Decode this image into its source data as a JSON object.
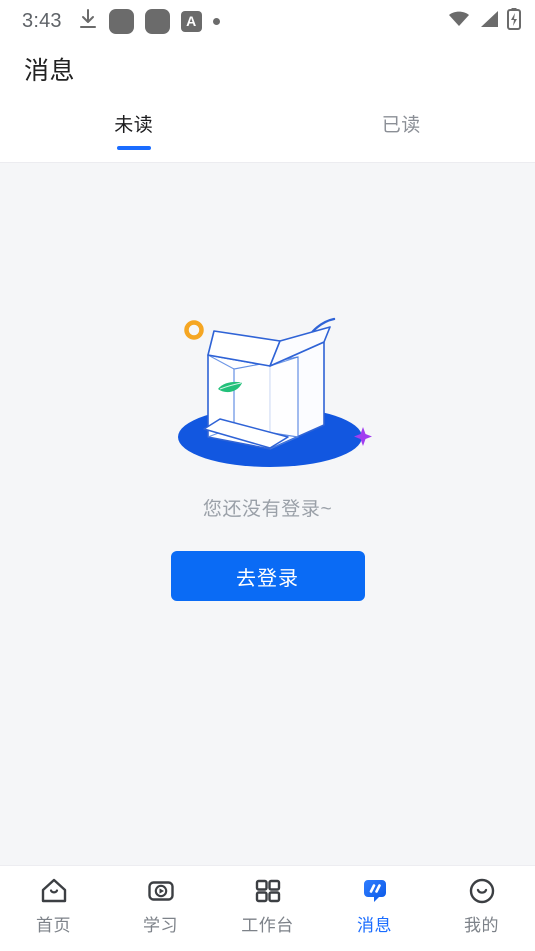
{
  "status_bar": {
    "time": "3:43",
    "left_icons": [
      "download-icon",
      "app-square-icon",
      "app-square-icon",
      "translate-a-icon",
      "dot-icon"
    ],
    "right_icons": [
      "wifi-icon",
      "cellular-signal-icon",
      "battery-charging-icon"
    ],
    "translate_letter": "A"
  },
  "header": {
    "title": "消息"
  },
  "tabs": [
    {
      "label": "未读",
      "active": true
    },
    {
      "label": "已读",
      "active": false
    }
  ],
  "empty_state": {
    "illustration": "empty-box-illustration",
    "message": "您还没有登录~",
    "button_label": "去登录"
  },
  "bottom_nav": [
    {
      "label": "首页",
      "icon": "home-icon",
      "active": false
    },
    {
      "label": "学习",
      "icon": "video-play-icon",
      "active": false
    },
    {
      "label": "工作台",
      "icon": "grid-apps-icon",
      "active": false
    },
    {
      "label": "消息",
      "icon": "message-bubble-icon",
      "active": true
    },
    {
      "label": "我的",
      "icon": "smiley-face-icon",
      "active": false
    }
  ],
  "colors": {
    "accent_blue": "#1a6cff",
    "button_blue": "#0a6bf5",
    "content_bg": "#f5f6f8",
    "inactive_gray": "#7d8289",
    "title_dark": "#222222",
    "leaf_green": "#22c07a",
    "ring_orange": "#f5a623",
    "sparkle_purple": "#a13df0"
  }
}
